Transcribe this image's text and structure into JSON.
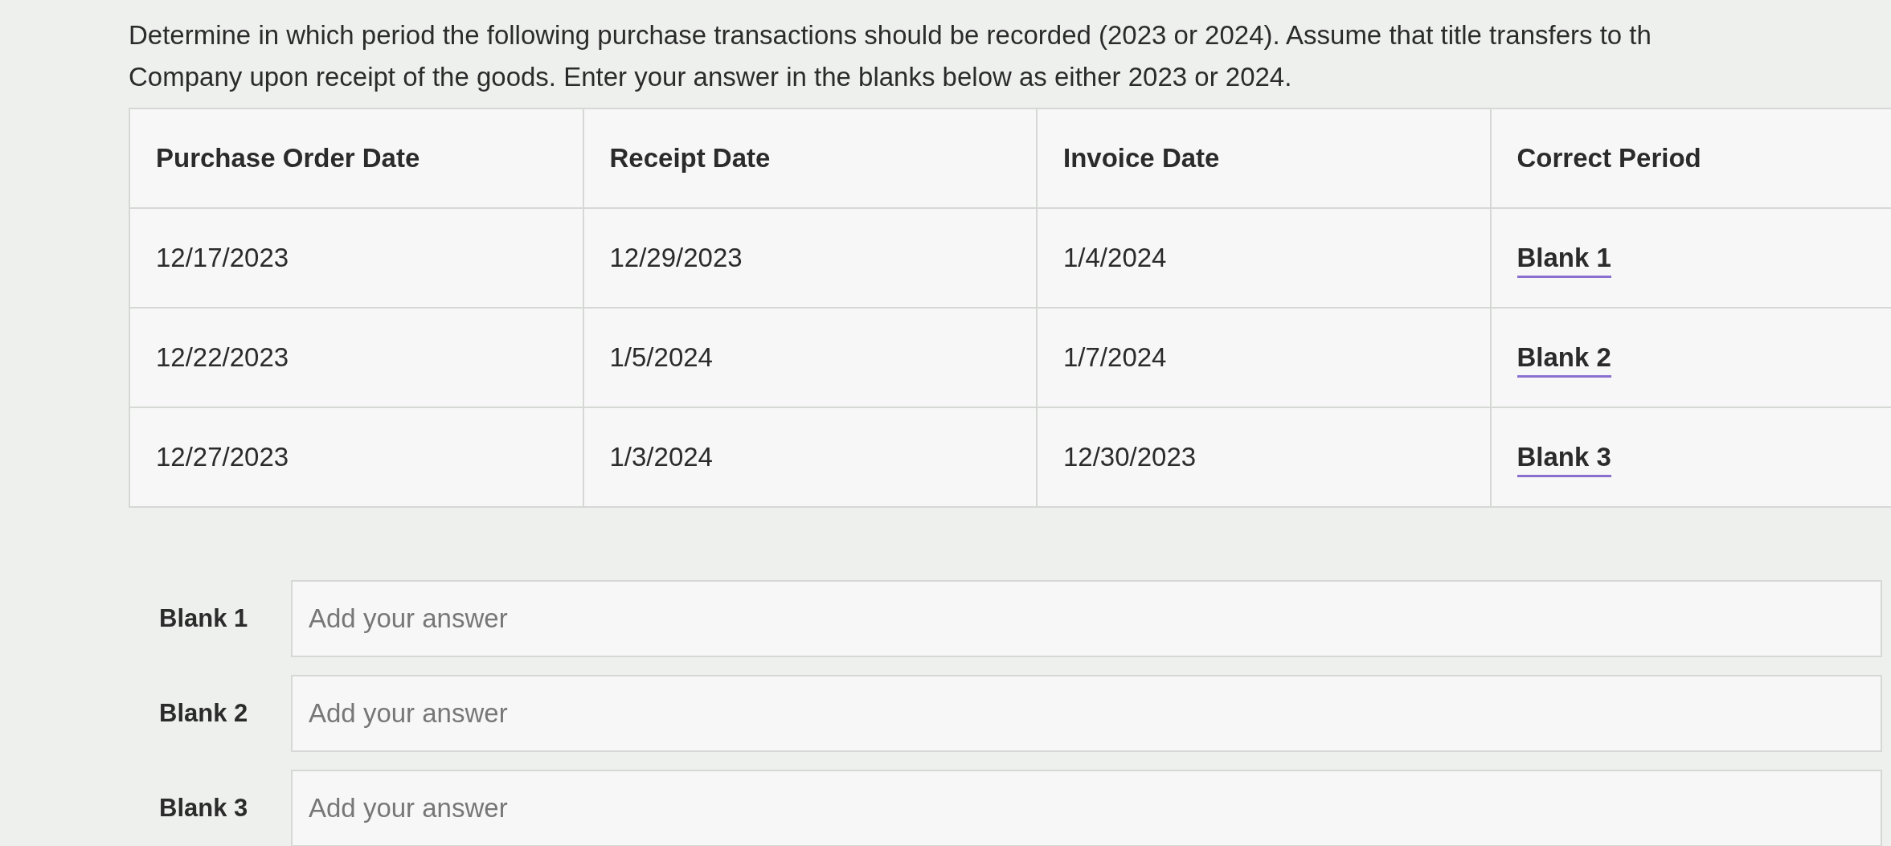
{
  "instructions": [
    "Determine in which period the following purchase transactions should be recorded (2023 or 2024). Assume that title transfers to th",
    "Company upon receipt of the goods. Enter your answer in the blanks below as either 2023 or 2024."
  ],
  "table": {
    "columns": [
      "Purchase Order Date",
      "Receipt Date",
      "Invoice Date",
      "Correct Period"
    ],
    "rows": [
      {
        "cells": [
          "12/17/2023",
          "12/29/2023",
          "1/4/2024"
        ],
        "blank": "Blank 1"
      },
      {
        "cells": [
          "12/22/2023",
          "1/5/2024",
          "1/7/2024"
        ],
        "blank": "Blank 2"
      },
      {
        "cells": [
          "12/27/2023",
          "1/3/2024",
          "12/30/2023"
        ],
        "blank": "Blank 3"
      }
    ]
  },
  "answers": [
    {
      "label": "Blank 1",
      "placeholder": "Add your answer"
    },
    {
      "label": "Blank 2",
      "placeholder": "Add your answer"
    },
    {
      "label": "Blank 3",
      "placeholder": "Add your answer"
    }
  ]
}
